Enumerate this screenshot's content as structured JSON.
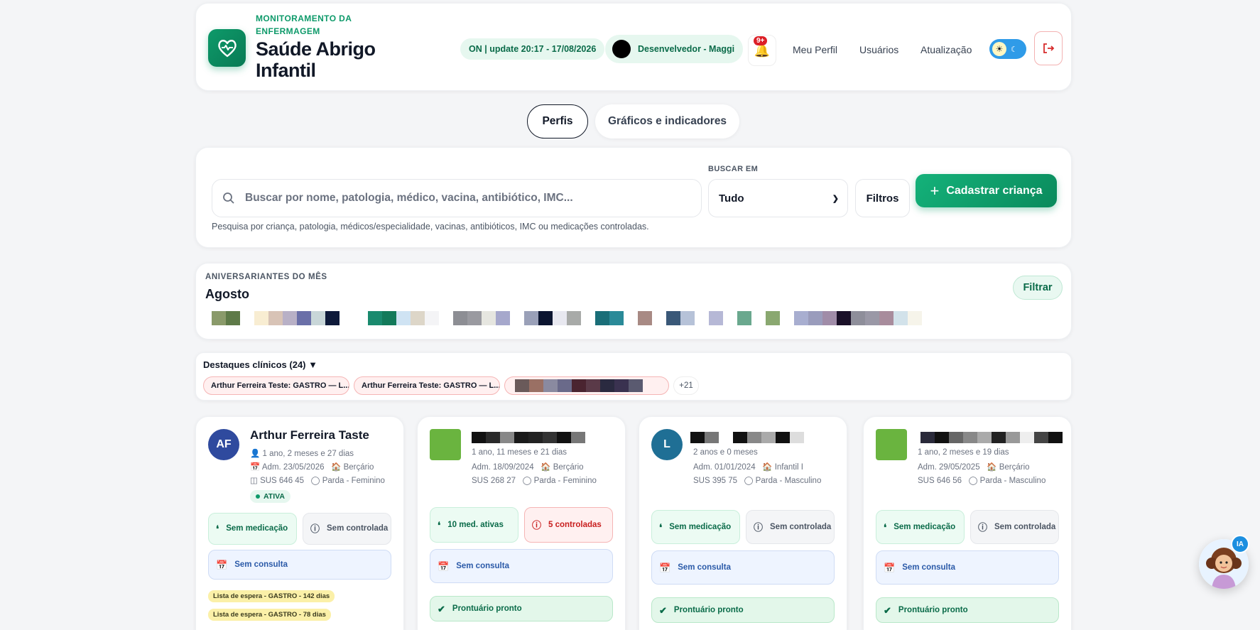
{
  "header": {
    "eyebrow": "MONITORAMENTO DA ENFERMAGEM",
    "title": "Saúde Abrigo Infantil",
    "status": "ON | update 20:17 - 17/08/2026",
    "user": "Desenvelvedor - Maggi",
    "notifications_badge": "9+",
    "nav": [
      "Meu Perfil",
      "Usuários",
      "Atualização"
    ]
  },
  "tabs": [
    {
      "label": "Perfis",
      "active": true
    },
    {
      "label": "Gráficos e indicadores",
      "active": false
    }
  ],
  "search": {
    "placeholder": "Buscar por nome, patologia, médico, vacina, antibiótico, IMC...",
    "hint": "Pesquisa por criança, patologia, médicos/especialidade, vacinas, antibióticos, IMC ou medicações controladas.",
    "scope_label": "BUSCAR EM",
    "scope_value": "Tudo",
    "filters_label": "Filtros",
    "add_label": "Cadastrar criança"
  },
  "birthdays": {
    "label": "ANIVERSARIANTES DO MÊS",
    "month": "Agosto",
    "filter_label": "Filtrar"
  },
  "highlights": {
    "title": "Destaques clínicos (24) ▼",
    "chips": [
      "Arthur Ferreira Teste: GASTRO — L...",
      "Arthur Ferreira Teste: GASTRO — L..."
    ],
    "more": "+21"
  },
  "profiles": [
    {
      "initials": "AF",
      "avatar_color": "#2f4a9e",
      "name": "Arthur Ferreira Taste",
      "age": "1 ano, 2 meses e 27 dias",
      "adm": "Adm. 23/05/2026",
      "group": "Berçário",
      "sus": "SUS 646 45",
      "demo": "Parda - Feminino",
      "status": "ATIVA",
      "med": "Sem medicação",
      "ctrl": "Sem controlada",
      "consult": "Sem consulta",
      "waitlist": [
        "Lista de espera - GASTRO - 142 dias",
        "Lista de espera - GASTRO - 78 dias"
      ]
    },
    {
      "age": "1 ano, 11 meses e 21 dias",
      "adm": "Adm. 18/09/2024",
      "group": "Berçário",
      "sus": "SUS 268 27",
      "demo": "Parda - Feminino",
      "med": "10 med. ativas",
      "ctrl": "5 controladas",
      "consult": "Sem consulta",
      "record": "Prontuário pronto"
    },
    {
      "initials": "L",
      "avatar_color": "#1f6f95",
      "age": "2 anos e 0 meses",
      "adm": "Adm. 01/01/2024",
      "group": "Infantil I",
      "sus": "SUS 395 75",
      "demo": "Parda - Masculino",
      "med": "Sem medicação",
      "ctrl": "Sem controlada",
      "consult": "Sem consulta",
      "record": "Prontuário pronto"
    },
    {
      "age": "1 ano, 2 meses e 19 dias",
      "adm": "Adm. 29/05/2025",
      "group": "Berçário",
      "sus": "SUS 646 56",
      "demo": "Parda - Masculino",
      "med": "Sem medicação",
      "ctrl": "Sem controlada",
      "consult": "Sem consulta",
      "record": "Prontuário pronto"
    }
  ],
  "assistant_badge": "IA",
  "colors": {
    "brand": "#0e9a6a",
    "danger": "#dc1f26",
    "info": "#2b5aa8"
  }
}
